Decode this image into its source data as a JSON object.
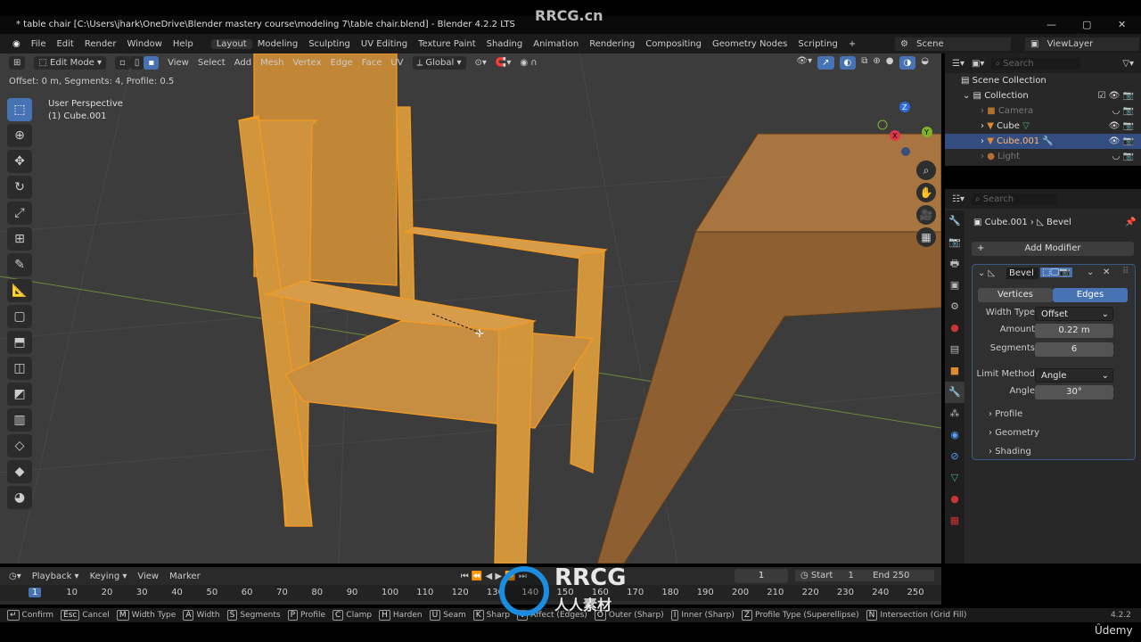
{
  "window": {
    "title": "* table chair [C:\\Users\\jhark\\OneDrive\\Blender mastery course\\modeling 7\\table chair.blend] - Blender 4.2.2 LTS",
    "watermark": "RRCG.cn"
  },
  "menu": {
    "items": [
      "File",
      "Edit",
      "Render",
      "Window",
      "Help"
    ],
    "workspaces": [
      "Layout",
      "Modeling",
      "Sculpting",
      "UV Editing",
      "Texture Paint",
      "Shading",
      "Animation",
      "Rendering",
      "Compositing",
      "Geometry Nodes",
      "Scripting"
    ],
    "active_workspace": "Layout",
    "add": "+",
    "scene": "Scene",
    "view_layer": "ViewLayer"
  },
  "viewport": {
    "mode": "Edit Mode",
    "menus": [
      "View",
      "Select",
      "Add",
      "Mesh",
      "Vertex",
      "Edge",
      "Face",
      "UV"
    ],
    "orientation": "Global",
    "operator_info": "Offset: 0 m, Segments: 4, Profile: 0.5",
    "perspective": "User Perspective",
    "object": "(1) Cube.001",
    "gizmo": {
      "x": "X",
      "y": "Y",
      "z": "Z"
    }
  },
  "outliner": {
    "search_placeholder": "Search",
    "scene_collection": "Scene Collection",
    "collection": "Collection",
    "items": [
      {
        "name": "Camera",
        "hidden": true
      },
      {
        "name": "Cube",
        "hidden": false
      },
      {
        "name": "Cube.001",
        "selected": true,
        "hidden": false
      },
      {
        "name": "Light",
        "hidden": true
      }
    ]
  },
  "properties": {
    "search_placeholder": "Search",
    "breadcrumb_object": "Cube.001",
    "breadcrumb_modifier": "Bevel",
    "add_modifier": "Add Modifier",
    "modifier": {
      "name": "Bevel",
      "affect_options": [
        "Vertices",
        "Edges"
      ],
      "affect_selected": "Edges",
      "width_type_label": "Width Type",
      "width_type": "Offset",
      "amount_label": "Amount",
      "amount": "0.22 m",
      "segments_label": "Segments",
      "segments": "6",
      "limit_method_label": "Limit Method",
      "limit_method": "Angle",
      "angle_label": "Angle",
      "angle": "30°",
      "panels": [
        "Profile",
        "Geometry",
        "Shading"
      ]
    }
  },
  "timeline": {
    "menus": [
      "Playback",
      "Keying",
      "View",
      "Marker"
    ],
    "current_frame": "1",
    "start_label": "Start",
    "start": "1",
    "end_label": "End",
    "end": "250",
    "ticks": [
      "1",
      "10",
      "20",
      "30",
      "40",
      "50",
      "60",
      "70",
      "80",
      "90",
      "100",
      "110",
      "120",
      "130",
      "140",
      "150",
      "160",
      "170",
      "180",
      "190",
      "200",
      "210",
      "220",
      "230",
      "240",
      "250"
    ]
  },
  "statusbar": {
    "items": [
      {
        "key": "↵",
        "label": "Confirm"
      },
      {
        "key": "Esc",
        "label": "Cancel"
      },
      {
        "key": "M",
        "label": "Width Type"
      },
      {
        "key": "A",
        "label": "Width"
      },
      {
        "key": "S",
        "label": "Segments"
      },
      {
        "key": "P",
        "label": "Profile"
      },
      {
        "key": "C",
        "label": "Clamp"
      },
      {
        "key": "H",
        "label": "Harden"
      },
      {
        "key": "U",
        "label": "Seam"
      },
      {
        "key": "K",
        "label": "Sharp"
      },
      {
        "key": "V",
        "label": "Affect (Edges)"
      },
      {
        "key": "O",
        "label": "Outer (Sharp)"
      },
      {
        "key": "I",
        "label": "Inner (Sharp)"
      },
      {
        "key": "Z",
        "label": "Profile Type (Superellipse)"
      },
      {
        "key": "N",
        "label": "Intersection (Grid Fill)"
      }
    ],
    "version": "4.2.2",
    "brand": "Ûdemy",
    "logo_text": "RRCG 人人素材"
  },
  "colors": {
    "accent": "#4772b3",
    "selection": "#ff9a1f",
    "wood": "#9c6a34"
  }
}
